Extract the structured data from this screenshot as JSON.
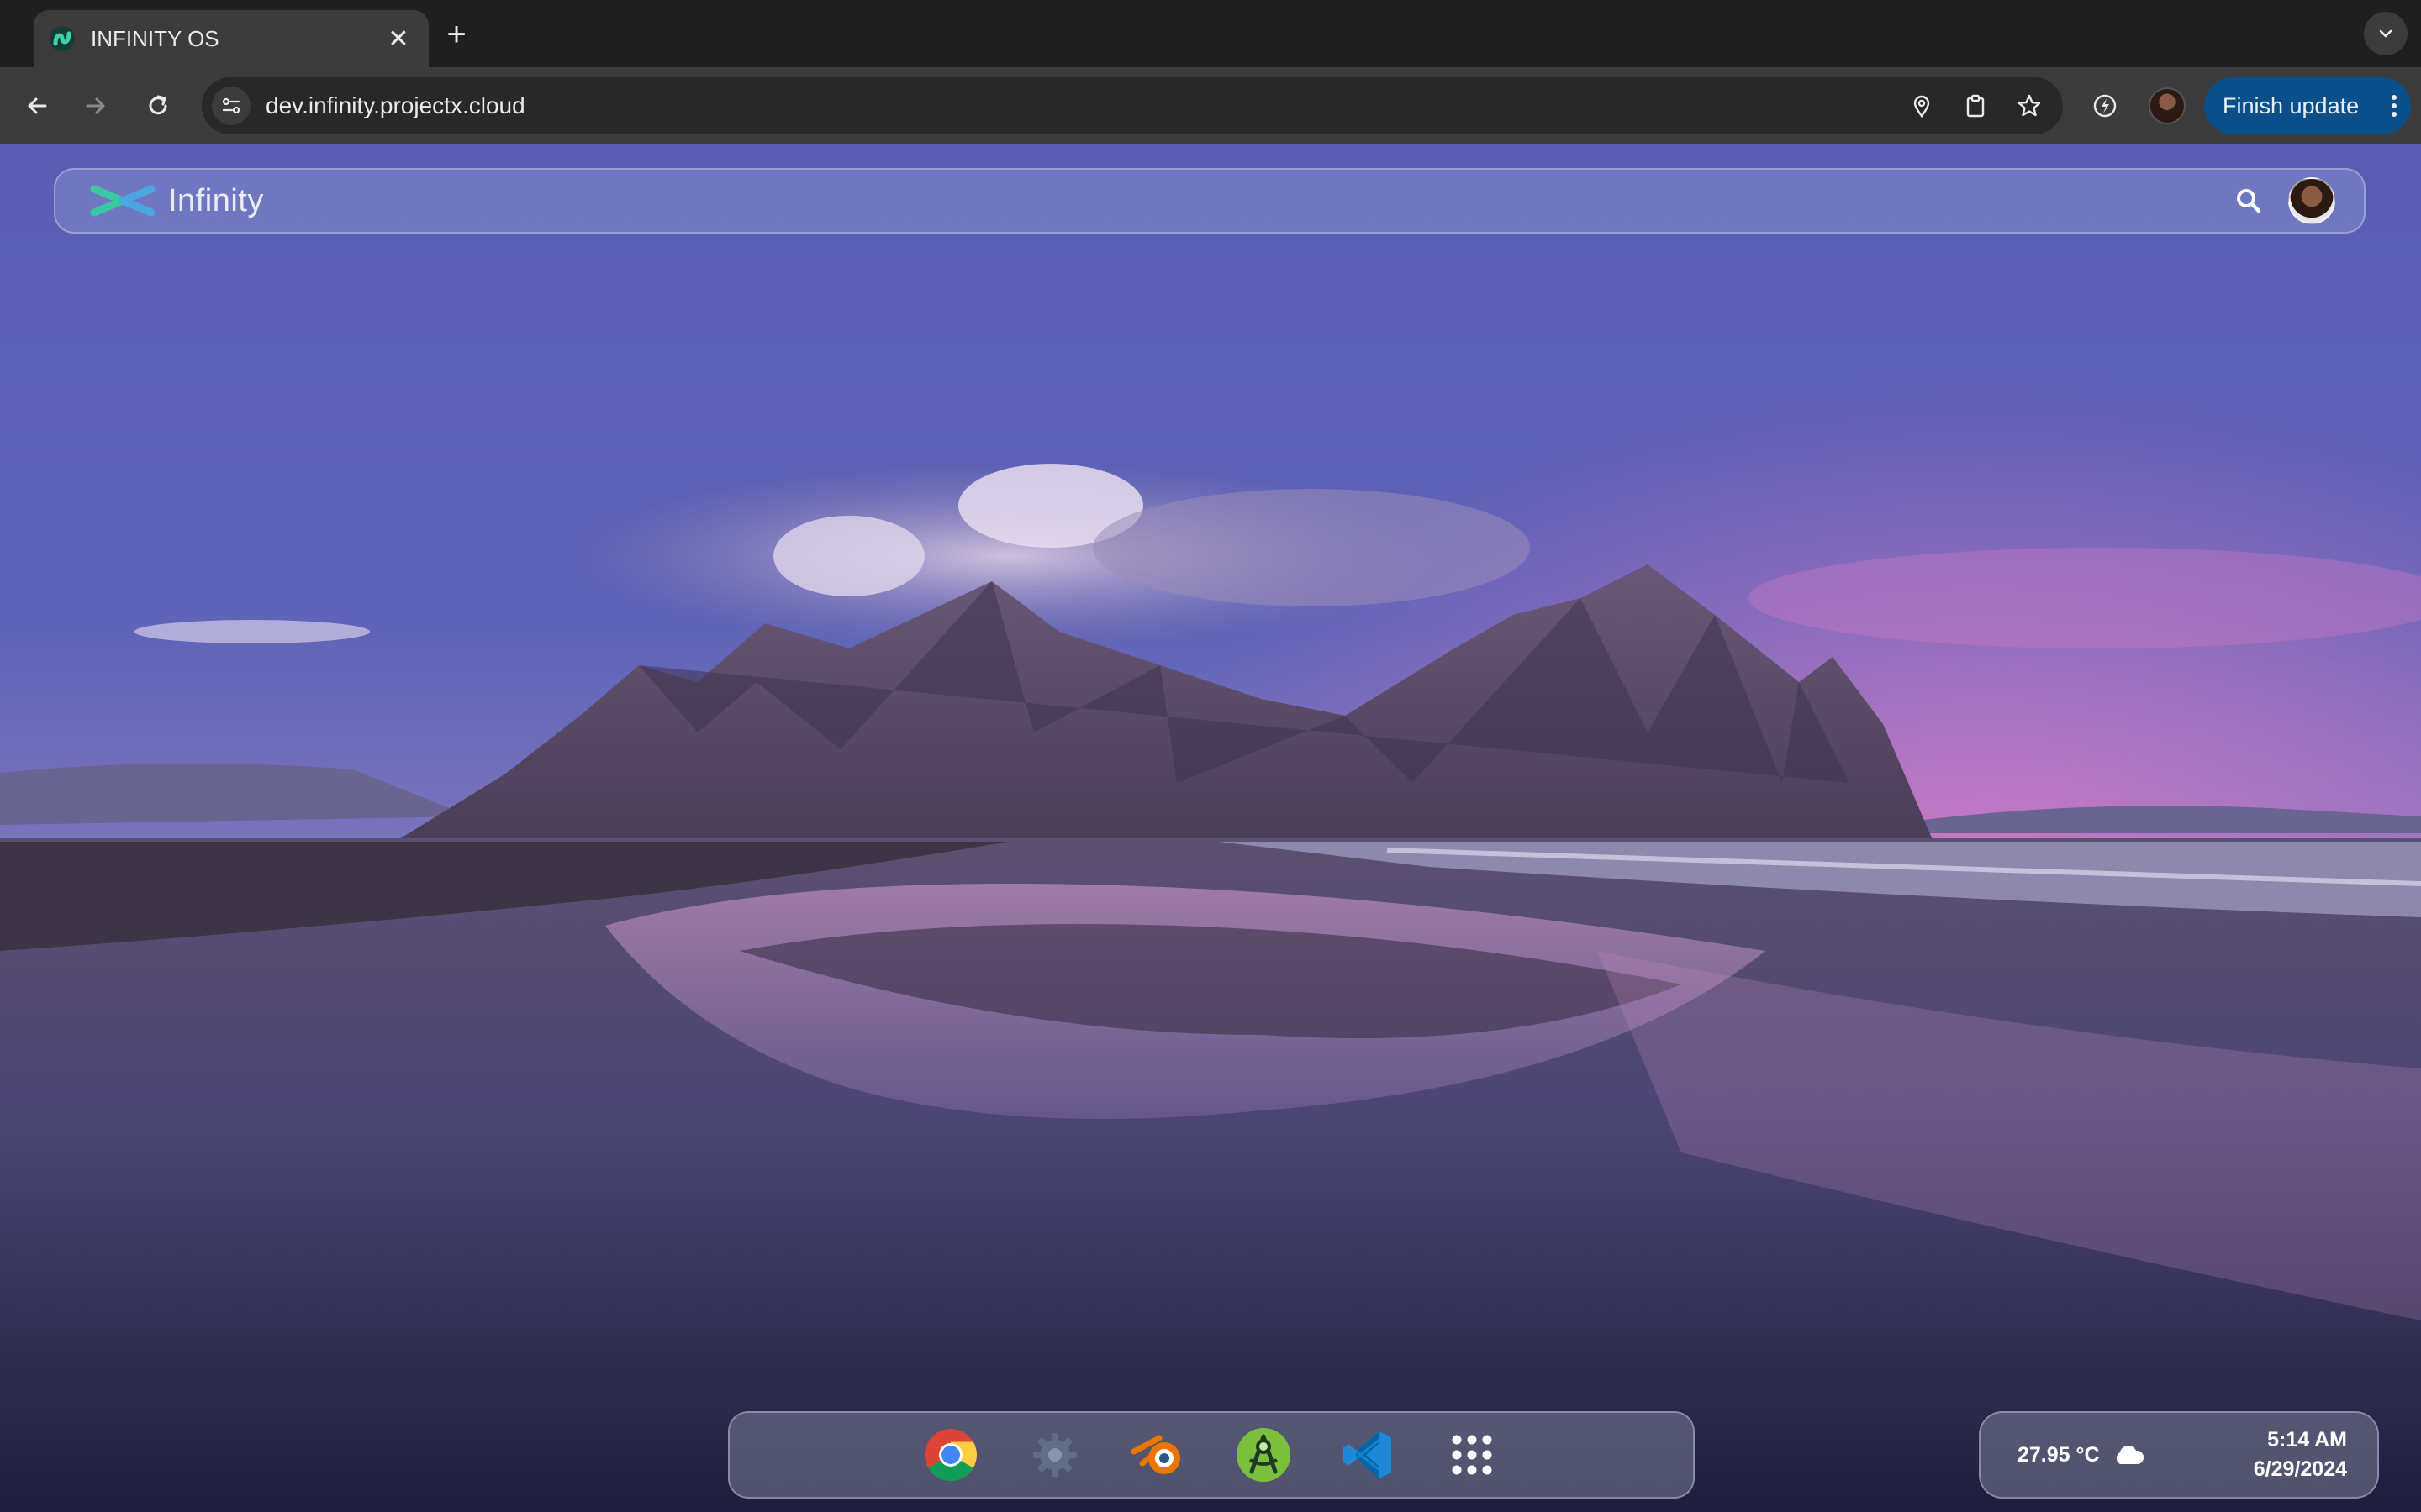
{
  "browser": {
    "tab": {
      "title": "INFINITY OS",
      "favicon": "infinity-favicon"
    },
    "new_tab_icon": "plus-icon",
    "tab_search_icon": "chevron-down-icon",
    "address_bar": {
      "url": "dev.infinity.projectx.cloud",
      "site_info_icon": "tune-icon",
      "location_icon": "location-pin-icon",
      "clipboard_icon": "clipboard-icon",
      "bookmark_icon": "star-icon"
    },
    "extensions_icon": "performance-icon",
    "finish_update_label": "Finish update",
    "accent": "#0b4f8a"
  },
  "desktop": {
    "wallpaper": "mountain-beach-sunset",
    "topbar": {
      "logo_text": "Infinity",
      "search_icon": "search-icon"
    },
    "dock": {
      "apps": [
        {
          "name": "Chrome",
          "icon": "chrome-icon"
        },
        {
          "name": "Settings",
          "icon": "gear-icon"
        },
        {
          "name": "Blender",
          "icon": "blender-icon"
        },
        {
          "name": "Android Studio",
          "icon": "android-studio-icon"
        },
        {
          "name": "VS Code",
          "icon": "vscode-icon"
        },
        {
          "name": "App Launcher",
          "icon": "grid-icon"
        }
      ]
    },
    "tray": {
      "temperature": "27.95 °C",
      "weather_icon": "cloud-icon",
      "time": "5:14 AM",
      "date": "6/29/2024"
    }
  }
}
